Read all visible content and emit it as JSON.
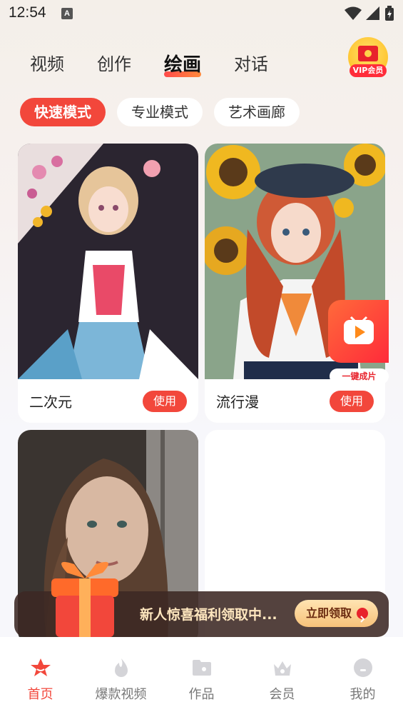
{
  "status_bar": {
    "time": "12:54",
    "notification_icon": "A"
  },
  "top_tabs": [
    {
      "label": "视频"
    },
    {
      "label": "创作"
    },
    {
      "label": "绘画",
      "active": true
    },
    {
      "label": "对话"
    }
  ],
  "vip": {
    "label": "VIP会员"
  },
  "mode_chips": [
    {
      "label": "快速模式",
      "active": true
    },
    {
      "label": "专业模式"
    },
    {
      "label": "艺术画廊"
    }
  ],
  "cards": [
    {
      "title": "二次元",
      "button": "使用"
    },
    {
      "title": "流行漫",
      "button": "使用"
    },
    {
      "title": "",
      "button": ""
    },
    {
      "title": "",
      "button": ""
    }
  ],
  "float_widget": {
    "label": "一键成片"
  },
  "promo": {
    "text": "新人惊喜福利领取中...",
    "button": "立即领取"
  },
  "bottom_nav": [
    {
      "label": "首页",
      "icon": "home-star-icon",
      "active": true
    },
    {
      "label": "爆款视频",
      "icon": "flame-icon"
    },
    {
      "label": "作品",
      "icon": "folder-icon"
    },
    {
      "label": "会员",
      "icon": "crown-icon"
    },
    {
      "label": "我的",
      "icon": "profile-icon"
    }
  ],
  "colors": {
    "accent": "#f2473b",
    "promo_bg": "#3c2823",
    "vip_gold": "#ffc530"
  }
}
